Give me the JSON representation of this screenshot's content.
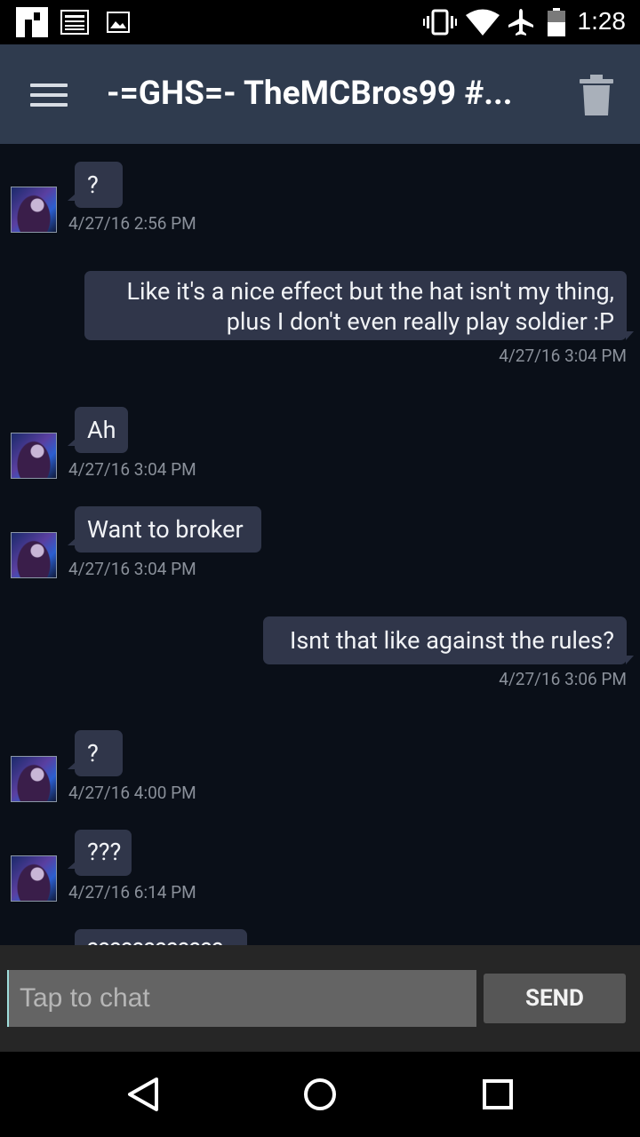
{
  "status_bar": {
    "time": "1:28",
    "icons": [
      "notification-app-icon",
      "notification-news-icon",
      "notification-image-icon",
      "vibrate-icon",
      "wifi-icon",
      "airplane-mode-icon",
      "battery-icon"
    ]
  },
  "header": {
    "title": "-=GHS=- TheMCBros99 #...",
    "menu_icon": "hamburger-menu-icon",
    "delete_icon": "trash-icon",
    "color": "#2f3b4e"
  },
  "messages": [
    {
      "direction": "in",
      "text": "?",
      "timestamp": "4/27/16 2:56 PM"
    },
    {
      "direction": "out",
      "lines": [
        "Like it's a nice effect but the hat isn't my thing,",
        "plus I don't even really play soldier :P"
      ],
      "timestamp": "4/27/16 3:04 PM"
    },
    {
      "direction": "in",
      "text": "Ah",
      "timestamp": "4/27/16 3:04 PM"
    },
    {
      "direction": "in",
      "text": "Want to broker",
      "timestamp": "4/27/16 3:04 PM"
    },
    {
      "direction": "out",
      "text": "Isnt that like against the rules?",
      "timestamp": "4/27/16 3:06 PM"
    },
    {
      "direction": "in",
      "text": "?",
      "timestamp": "4/27/16 4:00 PM"
    },
    {
      "direction": "in",
      "text": "???",
      "timestamp": "4/27/16 6:14 PM"
    },
    {
      "direction": "in",
      "text": "????????????",
      "timestamp": ""
    }
  ],
  "composer": {
    "placeholder": "Tap to chat",
    "value": "",
    "send_label": "SEND"
  },
  "nav_bar": {
    "icons": [
      "back-icon",
      "home-icon",
      "recents-icon"
    ]
  }
}
